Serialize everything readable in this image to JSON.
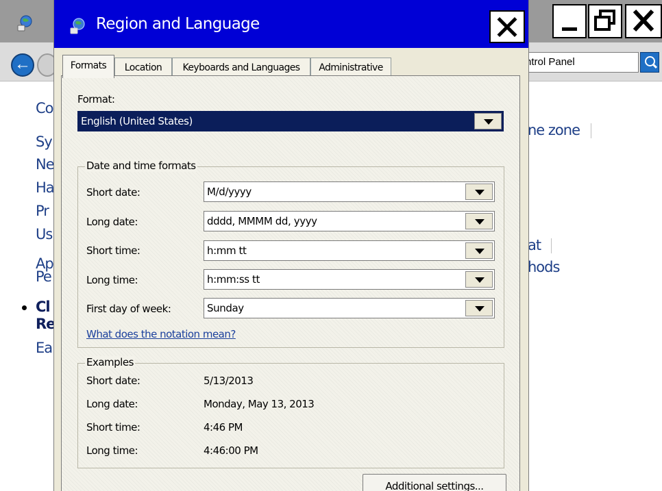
{
  "background_window": {
    "search_text": "ntrol Panel",
    "links": [
      {
        "text": "Co"
      },
      {
        "text": "Sy"
      },
      {
        "text": "Ne"
      },
      {
        "text": "Ha"
      },
      {
        "text": "Pr"
      },
      {
        "text": "Us"
      },
      {
        "text": "Ap"
      },
      {
        "text": "Pe"
      },
      {
        "text": "Cl"
      },
      {
        "text": "Re"
      },
      {
        "text": "Ea"
      }
    ],
    "right_links": [
      {
        "text": "ne zone"
      },
      {
        "text": "at"
      },
      {
        "text": "hods"
      }
    ]
  },
  "dialog": {
    "title": "Region and Language",
    "tabs": [
      {
        "label": "Formats",
        "active": true
      },
      {
        "label": "Location",
        "active": false
      },
      {
        "label": "Keyboards and Languages",
        "active": false
      },
      {
        "label": "Administrative",
        "active": false
      }
    ],
    "format": {
      "label": "Format:",
      "value": "English (United States)"
    },
    "date_time_formats": {
      "title": "Date and time formats",
      "rows": [
        {
          "label": "Short date:",
          "value": "M/d/yyyy"
        },
        {
          "label": "Long date:",
          "value": "dddd, MMMM dd, yyyy"
        },
        {
          "label": "Short time:",
          "value": "h:mm tt"
        },
        {
          "label": "Long time:",
          "value": "h:mm:ss tt"
        },
        {
          "label": "First day of week:",
          "value": "Sunday"
        }
      ],
      "notation_link": "What does the notation mean?"
    },
    "examples": {
      "title": "Examples",
      "rows": [
        {
          "label": "Short date:",
          "value": "5/13/2013"
        },
        {
          "label": "Long date:",
          "value": "Monday, May 13, 2013"
        },
        {
          "label": "Short time:",
          "value": "4:46 PM"
        },
        {
          "label": "Long time:",
          "value": "4:46:00 PM"
        }
      ]
    },
    "additional_settings_label": "Additional settings..."
  },
  "colors": {
    "dialog_titlebar": "#0000d6",
    "selected_combo": "#0b1e5a",
    "link": "#1a3f9c"
  }
}
